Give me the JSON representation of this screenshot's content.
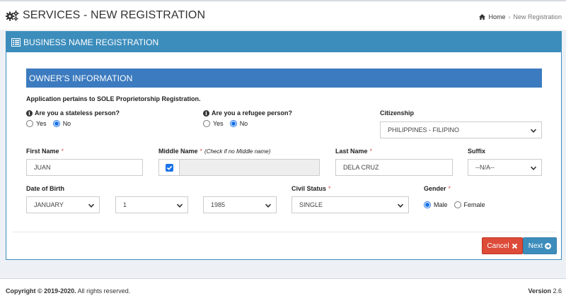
{
  "header": {
    "title": "SERVICES - NEW REGISTRATION",
    "breadcrumb": {
      "home": "Home",
      "current": "New Registration"
    }
  },
  "panel": {
    "title": "BUSINESS NAME REGISTRATION"
  },
  "owner": {
    "section_title": "OWNER'S INFORMATION",
    "note_prefix": "Application pertains to ",
    "note_bold": "SOLE",
    "note_suffix": " Proprietorship Registration.",
    "stateless": {
      "label": "Are you a stateless person?",
      "yes": "Yes",
      "no": "No",
      "selected": "No"
    },
    "refugee": {
      "label": "Are you a refugee person?",
      "yes": "Yes",
      "no": "No",
      "selected": "No"
    },
    "citizenship": {
      "label": "Citizenship",
      "value": "PHILIPPINES - FILIPINO"
    },
    "first_name": {
      "label": "First Name",
      "req": "*",
      "value": "JUAN"
    },
    "middle_name": {
      "label": "Middle Name",
      "req": "*",
      "hint": "(Check if no Middle name)",
      "no_middle_checked": true,
      "value": ""
    },
    "last_name": {
      "label": "Last Name",
      "req": "*",
      "value": "DELA CRUZ"
    },
    "suffix": {
      "label": "Suffix",
      "value": "--N/A--"
    },
    "dob": {
      "label": "Date of Birth",
      "month": "JANUARY",
      "day": "1",
      "year": "1985"
    },
    "civil_status": {
      "label": "Civil Status",
      "req": "*",
      "value": "SINGLE"
    },
    "gender": {
      "label": "Gender",
      "req": "*",
      "male": "Male",
      "female": "Female",
      "selected": "Male"
    }
  },
  "actions": {
    "cancel": "Cancel",
    "next": "Next"
  },
  "footer": {
    "copyright_bold": "Copyright © 2019-2020.",
    "copyright_rest": " All rights reserved.",
    "version_label": "Version",
    "version_value": "2.6"
  },
  "colors": {
    "primary": "#3c8dbc",
    "section": "#3c7bbf",
    "danger": "#dd4b39",
    "radio": "#1a73e8"
  }
}
